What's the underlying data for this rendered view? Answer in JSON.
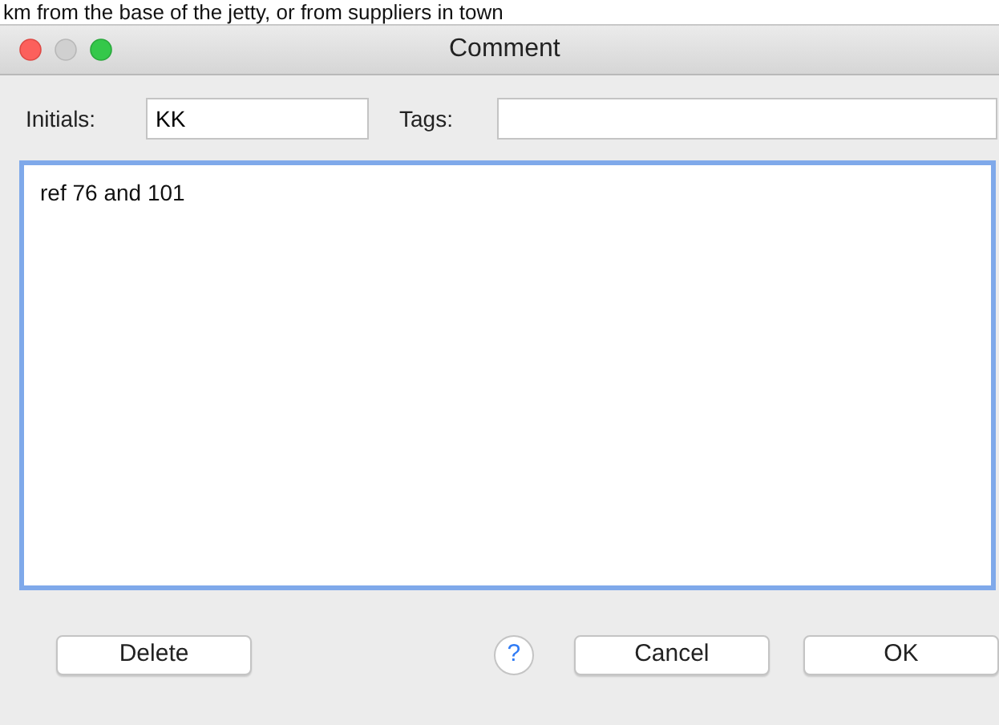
{
  "background_text": "km from the base of the jetty, or from suppliers in town",
  "window": {
    "title": "Comment"
  },
  "initials": {
    "label": "Initials:",
    "value": "KK"
  },
  "tags": {
    "label": "Tags:"
  },
  "comment": {
    "value": "ref 76 and 101",
    "focused": true
  },
  "buttons": [
    {
      "kind": "push",
      "label": "Delete"
    },
    {
      "kind": "help",
      "label": "?"
    },
    {
      "kind": "push",
      "label": "Cancel"
    },
    {
      "kind": "push",
      "label": "OK"
    }
  ]
}
